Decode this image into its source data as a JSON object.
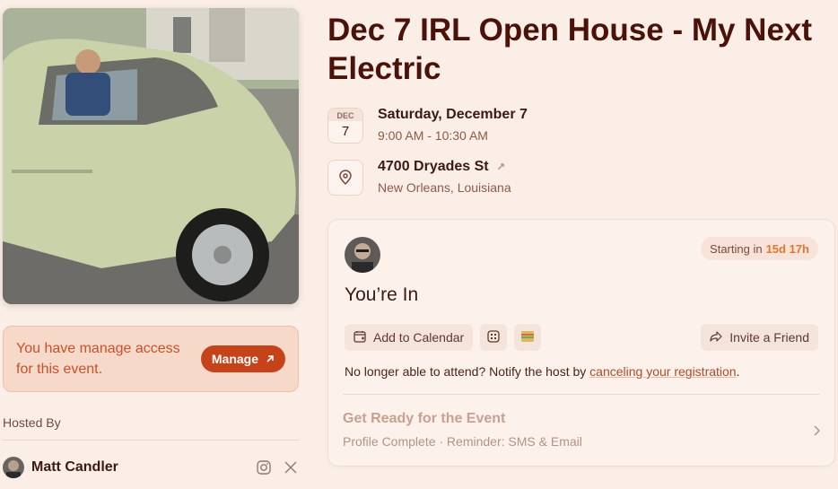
{
  "left": {
    "manage": {
      "text": "You have manage access for this event.",
      "button_label": "Manage"
    },
    "hosted_by_label": "Hosted By",
    "host": {
      "name": "Matt Candler"
    }
  },
  "event": {
    "title": "Dec 7 IRL Open House - My Next Electric",
    "date": {
      "month_abbr": "DEC",
      "day": "7",
      "full_date": "Saturday, December 7",
      "time_range": "9:00 AM - 10:30 AM"
    },
    "location": {
      "address": "4700 Dryades St",
      "city": "New Orleans, Louisiana"
    }
  },
  "registration": {
    "starting_label": "Starting in",
    "starting_countdown": "15d 17h",
    "status": "You’re In",
    "add_to_calendar": "Add to Calendar",
    "invite_friend": "Invite a Friend",
    "cancel_prefix": "No longer able to attend? Notify the host by ",
    "cancel_link": "canceling your registration",
    "cancel_suffix": ".",
    "get_ready_title": "Get Ready for the Event",
    "get_ready_sub": "Profile Complete · Reminder: SMS & Email"
  },
  "colors": {
    "background": "#fbeee6",
    "accent": "#c6431a",
    "title": "#4a1208",
    "countdown": "#e2762f"
  },
  "icons": {
    "location": "map-pin-icon",
    "calendar_add": "calendar-plus-icon",
    "qr": "qr-code-icon",
    "wallet": "wallet-icon",
    "invite": "share-arrow-icon",
    "instagram": "instagram-icon",
    "x": "x-logo-icon",
    "external": "external-arrow-icon",
    "chevron": "chevron-right-icon"
  }
}
